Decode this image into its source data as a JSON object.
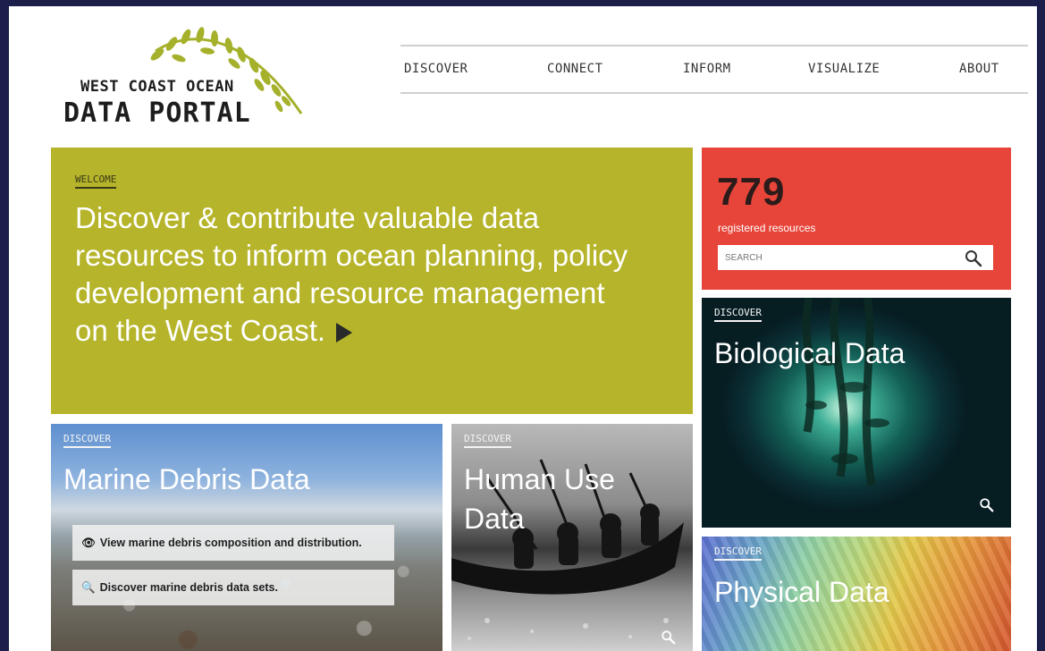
{
  "logo": {
    "line1": "WEST COAST OCEAN",
    "line2": "DATA PORTAL",
    "icon": "kelp-leaves-icon"
  },
  "nav": {
    "items": [
      "DISCOVER",
      "CONNECT",
      "INFORM",
      "VISUALIZE",
      "ABOUT"
    ]
  },
  "welcome": {
    "eyebrow": "WELCOME",
    "text": "Discover & contribute valuable data resources to inform ocean planning, policy development and resource management on the West Coast."
  },
  "resources": {
    "count": "779",
    "label": "registered resources",
    "search_placeholder": "SEARCH"
  },
  "tiles": {
    "biological": {
      "eyebrow": "DISCOVER",
      "title": "Biological Data"
    },
    "physical": {
      "eyebrow": "DISCOVER",
      "title": "Physical Data"
    },
    "marine": {
      "eyebrow": "DISCOVER",
      "title": "Marine Debris Data",
      "view_btn": "View marine debris composition and distribution.",
      "discover_btn": "Discover marine debris data sets."
    },
    "human": {
      "eyebrow": "DISCOVER",
      "title": "Human Use Data"
    }
  },
  "colors": {
    "background": "#1c1f4a",
    "welcome": "#b5b42a",
    "count_card": "#e8453a",
    "logo_leaf": "#a5b12a"
  }
}
